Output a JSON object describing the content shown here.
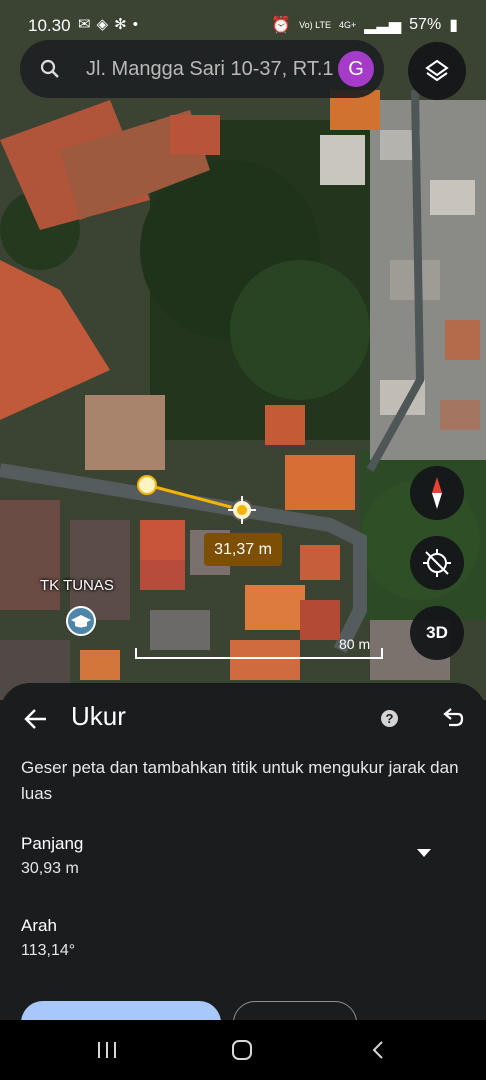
{
  "status_bar": {
    "time": "10.30",
    "left_icons": [
      "mail-icon",
      "location-shield-icon",
      "pinwheel-icon",
      "dot-icon"
    ],
    "right_icons": [
      "alarm-icon",
      "volte-icon",
      "signal-icon"
    ],
    "volte_label": "Vo) LTE",
    "network_label": "4G+",
    "battery_percent": "57%"
  },
  "search": {
    "query": "Jl. Mangga Sari 10-37, RT.1",
    "avatar_letter": "G",
    "avatar_color": "#a63ac9"
  },
  "map": {
    "measurement_label": "31,37 m",
    "scale_label": "80 m",
    "poi_label": "TK TUNAS",
    "poi_icon": "school-cap-icon",
    "compass_button_label": "",
    "threed_label": "3D",
    "line_color": "#f4b400"
  },
  "sheet": {
    "title": "Ukur",
    "description": "Geser peta dan tambahkan titik untuk mengukur jarak dan luas",
    "length_label": "Panjang",
    "length_value": "30,93 m",
    "direction_label": "Arah",
    "direction_value": "113,14°"
  },
  "navbar": {
    "icons": [
      "recents-icon",
      "home-icon",
      "back-icon"
    ]
  }
}
